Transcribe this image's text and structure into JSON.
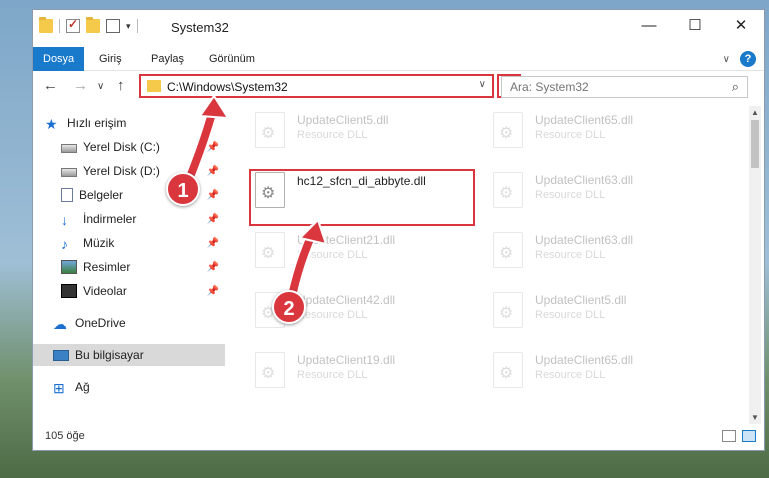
{
  "window": {
    "title": "System32",
    "minimize_icon": "—",
    "maximize_icon": "☐",
    "close_icon": "✕"
  },
  "ribbon": {
    "tabs": [
      {
        "label": "Dosya",
        "active": true
      },
      {
        "label": "Giriş",
        "active": false
      },
      {
        "label": "Paylaş",
        "active": false
      },
      {
        "label": "Görünüm",
        "active": false
      }
    ]
  },
  "address": {
    "path": "C:\\Windows\\System32",
    "search_placeholder": "Ara: System32"
  },
  "sidebar": {
    "items": [
      {
        "label": "Hızlı erişim",
        "icon": "star-icon"
      },
      {
        "label": "Yerel Disk (C:)",
        "icon": "drive-icon",
        "pinned": true
      },
      {
        "label": "Yerel Disk (D:)",
        "icon": "drive-icon",
        "pinned": true
      },
      {
        "label": "Belgeler",
        "icon": "document-icon",
        "pinned": true
      },
      {
        "label": "İndirmeler",
        "icon": "download-icon",
        "pinned": true
      },
      {
        "label": "Müzik",
        "icon": "music-icon",
        "pinned": true
      },
      {
        "label": "Resimler",
        "icon": "pictures-icon",
        "pinned": true
      },
      {
        "label": "Videolar",
        "icon": "video-icon",
        "pinned": true
      },
      {
        "label": "OneDrive",
        "icon": "cloud-icon"
      },
      {
        "label": "Bu bilgisayar",
        "icon": "computer-icon",
        "selected": true
      },
      {
        "label": "Ağ",
        "icon": "network-icon"
      }
    ]
  },
  "files": [
    {
      "name": "UpdateClient5.dll",
      "type": "Resource DLL"
    },
    {
      "name": "UpdateClient65.dll",
      "type": "Resource DLL"
    },
    {
      "name": "hc12_sfcn_di_abbyte.dll",
      "type": ""
    },
    {
      "name": "UpdateClient63.dll",
      "type": "Resource DLL"
    },
    {
      "name": "UpdateClient21.dll",
      "type": "Resource DLL"
    },
    {
      "name": "UpdateClient63.dll",
      "type": "Resource DLL"
    },
    {
      "name": "UpdateClient42.dll",
      "type": "Resource DLL"
    },
    {
      "name": "UpdateClient5.dll",
      "type": "Resource DLL"
    },
    {
      "name": "UpdateClient19.dll",
      "type": "Resource DLL"
    },
    {
      "name": "UpdateClient65.dll",
      "type": "Resource DLL"
    }
  ],
  "status": {
    "item_count": "105 öğe"
  },
  "annotations": {
    "step1": "1",
    "step2": "2",
    "color": "#d9363e"
  },
  "colors": {
    "accent": "#1979ca",
    "highlight": "#d9363e"
  }
}
